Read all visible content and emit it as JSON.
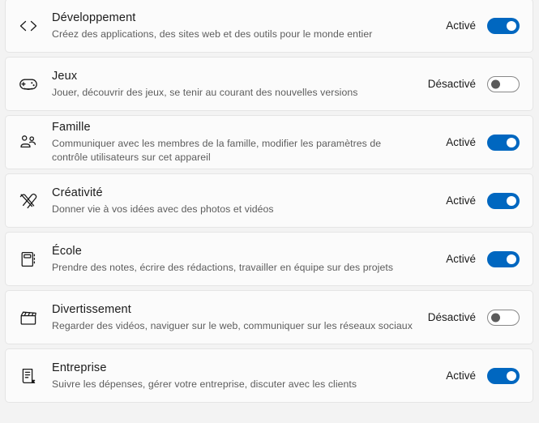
{
  "colors": {
    "accent": "#0067c0",
    "card_background": "#fbfbfb",
    "page_background": "#f3f3f3",
    "card_border": "#e5e5e5",
    "title_text": "#1b1b1b",
    "description_text": "#5d5d5d",
    "toggle_off_border": "#888888",
    "toggle_off_knob": "#5b5b5b"
  },
  "states": {
    "on": "Activé",
    "off": "Désactivé"
  },
  "categories": [
    {
      "icon": "code-brackets-icon",
      "title": "Développement",
      "description": "Créez des applications, des sites web et des outils pour le monde entier",
      "state_label": "Activé",
      "enabled": true
    },
    {
      "icon": "game-controller-icon",
      "title": "Jeux",
      "description": "Jouer, découvrir des jeux, se tenir au courant des nouvelles versions",
      "state_label": "Désactivé",
      "enabled": false
    },
    {
      "icon": "people-group-icon",
      "title": "Famille",
      "description": "Communiquer avec les membres de la famille, modifier les paramètres de contrôle utilisateurs sur cet appareil",
      "state_label": "Activé",
      "enabled": true
    },
    {
      "icon": "pen-brush-icon",
      "title": "Créativité",
      "description": "Donner vie à vos idées avec des photos et vidéos",
      "state_label": "Activé",
      "enabled": true
    },
    {
      "icon": "notebook-icon",
      "title": "École",
      "description": "Prendre des notes, écrire des rédactions, travailler en équipe sur des projets",
      "state_label": "Activé",
      "enabled": true
    },
    {
      "icon": "clapperboard-icon",
      "title": "Divertissement",
      "description": "Regarder des vidéos, naviguer sur le web, communiquer sur les réseaux sociaux",
      "state_label": "Désactivé",
      "enabled": false
    },
    {
      "icon": "document-icon",
      "title": "Entreprise",
      "description": "Suivre les dépenses, gérer votre entreprise, discuter avec les clients",
      "state_label": "Activé",
      "enabled": true
    }
  ]
}
